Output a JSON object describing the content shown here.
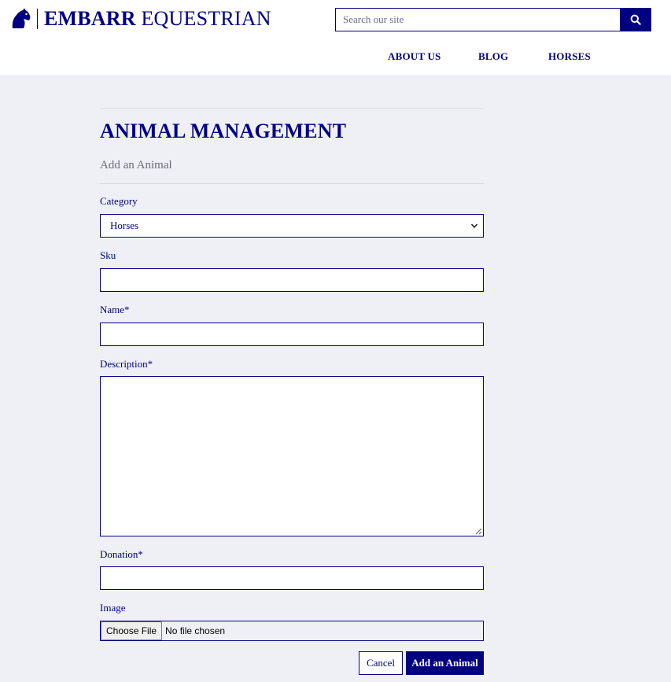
{
  "brand": {
    "name_bold": "EMBARR",
    "name_rest": " EQUESTRIAN",
    "logo_icon": "horse-head-icon"
  },
  "search": {
    "placeholder": "Search our site",
    "icon": "search-icon"
  },
  "nav": {
    "items": [
      {
        "label": "ABOUT US"
      },
      {
        "label": "BLOG"
      },
      {
        "label": "HORSES"
      }
    ]
  },
  "page": {
    "title": "ANIMAL MANAGEMENT",
    "subtitle": "Add an Animal"
  },
  "form": {
    "category": {
      "label": "Category",
      "value": "Horses"
    },
    "sku": {
      "label": "Sku",
      "value": ""
    },
    "name": {
      "label": "Name*",
      "value": ""
    },
    "description": {
      "label": "Description*",
      "value": ""
    },
    "donation": {
      "label": "Donation*",
      "value": ""
    },
    "image": {
      "label": "Image",
      "button_label": "Choose File",
      "status": "No file chosen"
    },
    "cancel_label": "Cancel",
    "submit_label": "Add an Animal"
  },
  "colors": {
    "brand_navy": "#000080",
    "page_background": "#eef0f6",
    "muted_text": "#6b6b7b"
  }
}
